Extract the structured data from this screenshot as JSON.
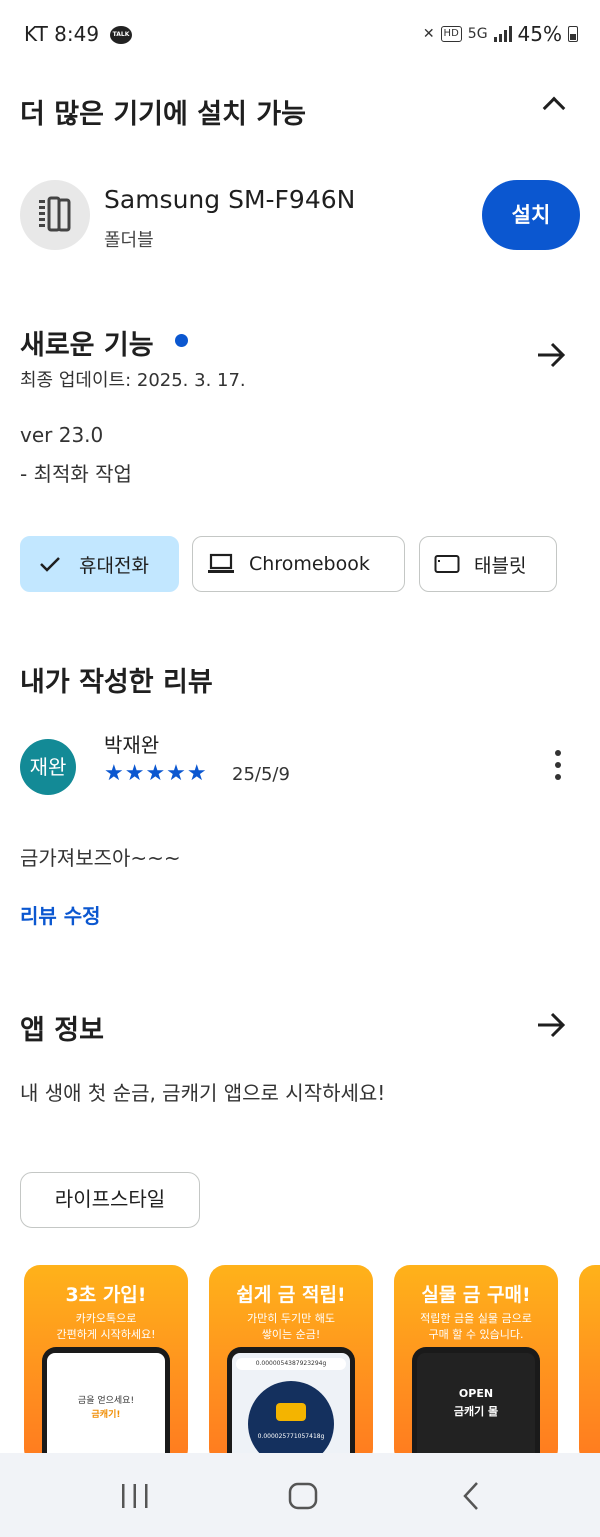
{
  "status": {
    "carrier_time": "KT 8:49",
    "talk_badge": "TALK",
    "mute": "✕",
    "hd": "HD",
    "net": "5G",
    "battery": "45%"
  },
  "install_section": {
    "title": "더 많은 기기에 설치 가능",
    "device_name": "Samsung SM-F946N",
    "device_type": "폴더블",
    "install_label": "설치"
  },
  "whats_new": {
    "title": "새로운 기능",
    "updated": "최종 업데이트: 2025. 3. 17.",
    "version": "ver 23.0",
    "note": "- 최적화 작업"
  },
  "device_chips": [
    {
      "label": "휴대전화",
      "icon": "check-icon",
      "selected": true
    },
    {
      "label": "Chromebook",
      "icon": "laptop-icon",
      "selected": false
    },
    {
      "label": "태블릿",
      "icon": "tablet-icon",
      "selected": false
    }
  ],
  "my_review": {
    "title": "내가 작성한 리뷰",
    "avatar_text": "재완",
    "reviewer": "박재완",
    "stars": "★★★★★",
    "rating": 5,
    "date": "25/5/9",
    "text": "금가져보즈아~~~",
    "edit_label": "리뷰 수정"
  },
  "app_info": {
    "title": "앱 정보",
    "description": "내 생애 첫 순금, 금캐기 앱으로 시작하세요!",
    "category": "라이프스타일"
  },
  "screenshots": [
    {
      "title": "3초 가입!",
      "subtitle": "카카오톡으로\n간편하게 시작하세요!",
      "screen_text": "금을 얻으세요!",
      "screen_sub": "금캐기!"
    },
    {
      "title": "쉽게 금 적립!",
      "subtitle": "가만히 두기만 해도\n쌓이는 순금!",
      "screen_text": "0.0000054387923294g",
      "screen_sub": "0.000025771057418g"
    },
    {
      "title": "실물 금 구매!",
      "subtitle": "적립한 금을 실물 금으로\n구매 할 수 있습니다.",
      "screen_text": "OPEN",
      "screen_sub": "금캐기 몰"
    }
  ],
  "colors": {
    "accent": "#0b57d0",
    "chip_selected": "#c2e7ff",
    "avatar": "#138a96",
    "banner_orange": "#ff8f1f"
  }
}
